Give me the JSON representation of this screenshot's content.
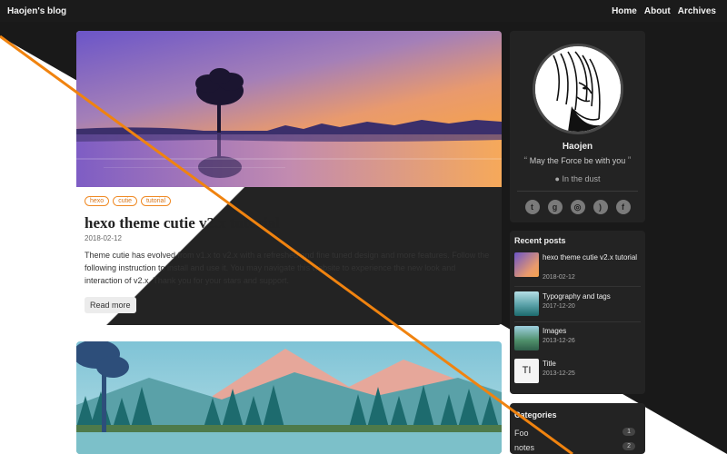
{
  "nav": {
    "brand": "Haojen's blog",
    "links": [
      "Home",
      "About",
      "Archives"
    ]
  },
  "post1": {
    "tags": [
      "hexo",
      "cutie",
      "tutorial"
    ],
    "title": "hexo theme cutie v2.x tutorial",
    "date": "2018-02-12",
    "excerpt": "Theme cutie has evolved from v1.x to v2.x with a refreshed and fine tuned design and more features. Follow the following instruction to install and use it. You may navigate this website to experience the new look and interaction of v2.x. Thank you for your stars and support.",
    "read_more": "Read more"
  },
  "profile": {
    "name": "Haojen",
    "motto": "May the Force be with you",
    "location": "In the dust",
    "socials": [
      "twitter-icon",
      "github-icon",
      "instagram-icon",
      "rss-icon",
      "facebook-icon"
    ]
  },
  "recent": {
    "title": "Recent posts",
    "items": [
      {
        "title": "hexo theme cutie v2.x tutorial",
        "date": "2018-02-12"
      },
      {
        "title": "Typography and tags",
        "date": "2017-12-20"
      },
      {
        "title": "Images",
        "date": "2013-12-26"
      },
      {
        "title": "Title",
        "date": "2013-12-25",
        "initials": "TI"
      }
    ]
  },
  "categories": {
    "title": "Categories",
    "items": [
      {
        "name": "Foo",
        "count": "1"
      },
      {
        "name": "notes",
        "count": "2"
      }
    ]
  },
  "colors": {
    "accent": "#f0830f",
    "tag": "#f08a24",
    "dark_bg": "#191919",
    "card_dark": "#232323"
  }
}
